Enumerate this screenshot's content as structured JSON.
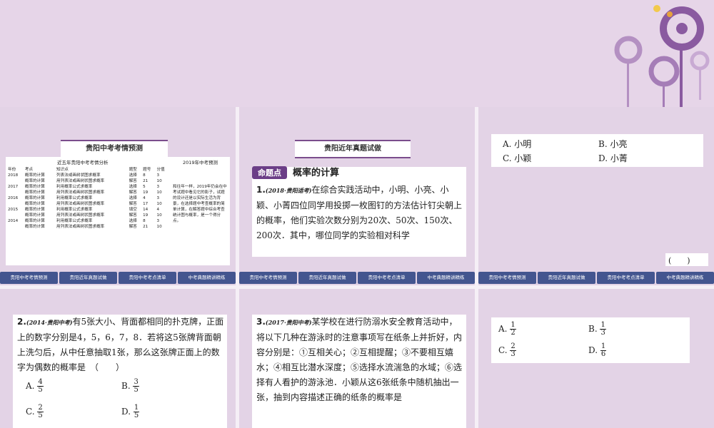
{
  "nav": [
    "贵阳中考考情预测",
    "贵阳近年真题试做",
    "贵阳中考考点清单",
    "中考典题精讲精练"
  ],
  "slide1": {
    "banner": "贵阳中考考情预测",
    "table_title": "近五年贵阳中考考情分析",
    "prediction_title": "2019年中考预测",
    "headers": [
      "年份",
      "考点",
      "知识点",
      "题型",
      "题号",
      "分值"
    ],
    "rows": [
      [
        "2018",
        "概率的计算",
        "列表法或画树状图求概率",
        "选择",
        "8",
        "3"
      ],
      [
        "",
        "概率的计算",
        "用列表法或画树状图求概率",
        "解答",
        "21",
        "10"
      ],
      [
        "2017",
        "概率的计算",
        "利用概率公式求概率",
        "选择",
        "5",
        "3"
      ],
      [
        "",
        "概率的计算",
        "用列表法或画树状图求概率",
        "解答",
        "19",
        "10"
      ],
      [
        "2016",
        "概率的计算",
        "利用概率公式求概率",
        "选择",
        "4",
        "3"
      ],
      [
        "",
        "概率的计算",
        "用列表法或画树状图求概率",
        "解答",
        "17",
        "10"
      ],
      [
        "2015",
        "概率的计算",
        "利用概率公式求概率",
        "填空",
        "14",
        "4"
      ],
      [
        "",
        "概率的计算",
        "用列表法或画树状图求概率",
        "解答",
        "19",
        "10"
      ],
      [
        "2014",
        "概率的计算",
        "利用概率公式求概率",
        "选择",
        "8",
        "3"
      ],
      [
        "",
        "概率的计算",
        "用列表法或画树状图求概率",
        "解答",
        "21",
        "10"
      ]
    ],
    "prediction_text": "和往年一样，2019年仍会在中考试题中看见它的影子，试题的设计还是以实际生活为背景，在选择题中考查概率的简单计算，在解答题中综合考查统计图与概率，是一个得分点。"
  },
  "slide2": {
    "banner": "贵阳近年真题试做",
    "tag": "命题点",
    "topic": "概率的计算",
    "num": "1.",
    "source": "(2018·贵阳适考)",
    "text": "在综合实践活动中，小明、小亮、小颖、小菁四位同学用投掷一枚图钉的方法估计钉尖朝上的概率，他们实验次数分别为20次、50次、150次、200次．其中，哪位同学的实验相对科学"
  },
  "slide3": {
    "options": [
      "A. 小明",
      "B. 小亮",
      "C. 小颖",
      "D. 小菁"
    ],
    "blank": "(　　)"
  },
  "slide4": {
    "num": "2.",
    "source": "(2014·贵阳中考)",
    "text": "有5张大小、背面都相同的扑克牌，正面上的数字分别是4，5，6，7，8．若将这5张牌背面朝上洗匀后，从中任意抽取1张，那么这张牌正面上的数字为偶数的概率是　（　　）",
    "options": [
      {
        "label": "A.",
        "num": "4",
        "den": "5"
      },
      {
        "label": "B.",
        "num": "3",
        "den": "5"
      },
      {
        "label": "C.",
        "num": "2",
        "den": "5"
      },
      {
        "label": "D.",
        "num": "1",
        "den": "5"
      }
    ]
  },
  "slide5": {
    "num": "3.",
    "source": "(2017·贵阳中考)",
    "text": "某学校在进行防溺水安全教育活动中，将以下几种在游泳时的注意事项写在纸条上并折好，内容分别是：①互相关心；②互相提醒；③不要相互嬉水；④相互比潜水深度；⑤选择水流湍急的水域；⑥选择有人看护的游泳池．小颖从这6张纸条中随机抽出一张，抽到内容描述正确的纸条的概率是"
  },
  "slide6": {
    "options": [
      {
        "label": "A.",
        "num": "1",
        "den": "2"
      },
      {
        "label": "B.",
        "num": "1",
        "den": "3"
      },
      {
        "label": "C.",
        "num": "2",
        "den": "3"
      },
      {
        "label": "D.",
        "num": "1",
        "den": "6"
      }
    ]
  },
  "colors": {
    "nav": "#43558f",
    "accent": "#6b3e87",
    "background": "#e2d1e5"
  }
}
